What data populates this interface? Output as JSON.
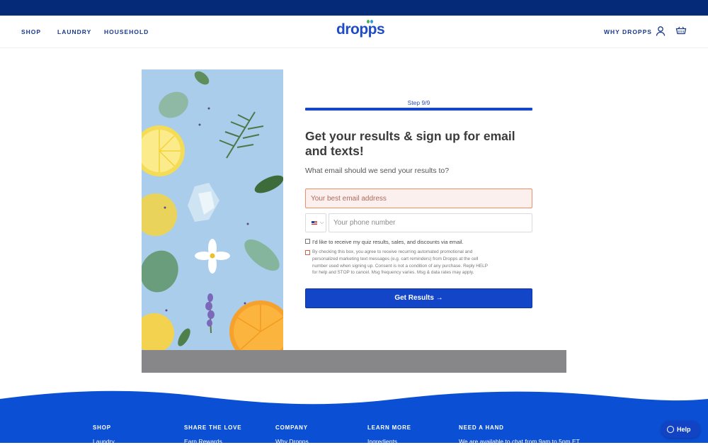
{
  "nav": {
    "left": [
      "SHOP",
      "LAUNDRY",
      "HOUSEHOLD"
    ],
    "logo": "dropps",
    "right_link": "WHY DROPPS"
  },
  "form": {
    "step": "Step 9/9",
    "progress": 1.0,
    "heading": "Get your results & sign up for email and texts!",
    "subheading": "What email should we send your results to?",
    "email_placeholder": "Your best email address",
    "email_value": "",
    "phone_placeholder": "Your phone number",
    "phone_value": "",
    "email_consent_label": "I'd like to receive my quiz results, sales, and discounts via email.",
    "sms_consent_text": "By checking this box, you agree to receive recurring automated promotional and personalized marketing text messages (e.g. cart reminders) from Dropps at the cell number used when signing up. Consent is not a condition of any purchase. Reply HELP for help and STOP to cancel. Msg frequency varies. Msg & data rates may apply.",
    "submit_label": "Get Results →"
  },
  "footer": {
    "columns": [
      {
        "title": "SHOP",
        "first_link": "Laundry"
      },
      {
        "title": "SHARE THE LOVE",
        "first_link": "Earn Rewards"
      },
      {
        "title": "COMPANY",
        "first_link": "Why Dropps"
      },
      {
        "title": "LEARN MORE",
        "first_link": "Ingredients"
      },
      {
        "title": "NEED A HAND",
        "first_link": "We are available to chat from 9am to 5pm ET"
      }
    ]
  },
  "help_button": "Help",
  "colors": {
    "brand_blue": "#1245c8",
    "top_bar": "#052a78",
    "footer_blue": "#0a4fd4"
  }
}
